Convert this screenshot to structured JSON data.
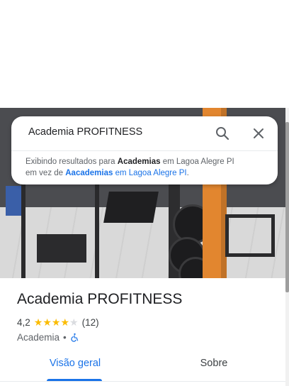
{
  "search": {
    "query": "Academia PROFITNESS",
    "icon_search": "search-icon",
    "icon_close": "close-icon"
  },
  "suggestion": {
    "prefix": "Exibindo resultados para ",
    "shown_term": "Academias",
    "shown_location": " em Lagoa Alegre PI",
    "instead_prefix": "em vez de ",
    "alt_term": "Aacademias",
    "alt_location": " em Lagoa Alegre PI",
    "suffix": "."
  },
  "place": {
    "name": "Academia PROFITNESS",
    "rating": "4,2",
    "rating_value": 4.2,
    "stars_filled": 4,
    "stars_total": 5,
    "review_count": "(12)",
    "category": "Academia",
    "separator": "•",
    "accessibility_icon": "wheelchair-icon"
  },
  "tabs": [
    {
      "label": "Visão geral",
      "active": true
    },
    {
      "label": "Sobre",
      "active": false
    }
  ],
  "colors": {
    "accent": "#1a73e8",
    "star": "#fbbc04",
    "column": "#e2862f"
  }
}
